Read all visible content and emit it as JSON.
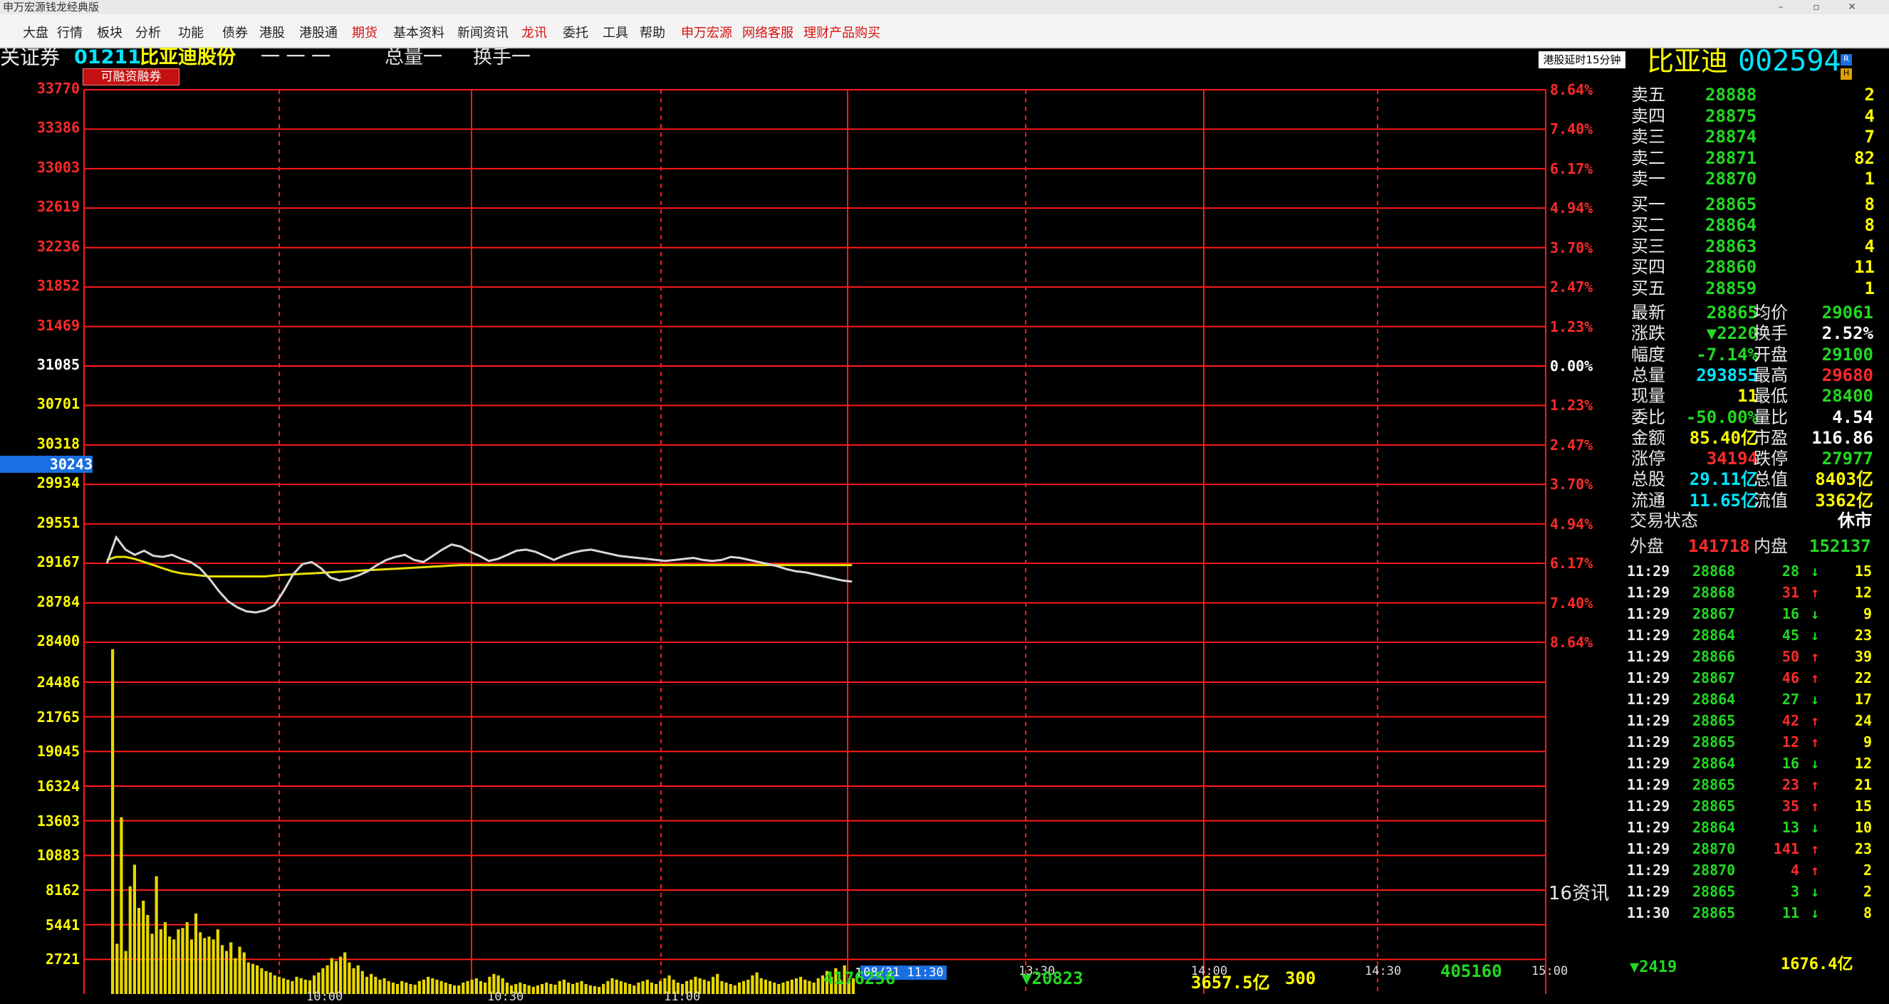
{
  "window": {
    "title": "申万宏源钱龙经典版"
  },
  "menu": [
    "大盘",
    "行情",
    "板块",
    "分析",
    "功能",
    "债券",
    "港股",
    "港股通",
    "期货",
    "基本资料",
    "新闻资讯",
    "龙讯",
    "委托",
    "工具",
    "帮助",
    "申万宏源",
    "网络客服",
    "理财产品购买"
  ],
  "header": {
    "category": "关证券",
    "code": "01211",
    "name": "比亚迪股份",
    "dashes": "一 一 一",
    "vol_label": "总量一",
    "turnover_label": "换手一",
    "margin_badge": "可融资融券",
    "delay_note": "港股延时15分钟",
    "right_name": "比亚迪",
    "right_code": "002594"
  },
  "chart_data": {
    "type": "line",
    "left_axis_ticks": [
      "33770",
      "33386",
      "33003",
      "32619",
      "32236",
      "31852",
      "31469",
      "31085",
      "30701",
      "30318",
      "29934",
      "29551",
      "29167",
      "28784",
      "28400"
    ],
    "right_axis_ticks": [
      "8.64%",
      "7.40%",
      "6.17%",
      "4.94%",
      "3.70%",
      "2.47%",
      "1.23%",
      "0.00%",
      "1.23%",
      "2.47%",
      "3.70%",
      "4.94%",
      "6.17%",
      "7.40%",
      "8.64%"
    ],
    "volume_ticks": [
      "24486",
      "21765",
      "19045",
      "16324",
      "13603",
      "10883",
      "8162",
      "5441",
      "2721"
    ],
    "cursor_value": "30243",
    "x_ticks": [
      "10:00",
      "10:30",
      "11:00",
      "13:30",
      "14:00",
      "14:30",
      "15:00"
    ],
    "x_partial": "11",
    "timestamp": "08/31 11:30",
    "price_series": [
      29167,
      29420,
      29300,
      29250,
      29290,
      29240,
      29230,
      29250,
      29210,
      29180,
      29120,
      29020,
      28900,
      28800,
      28740,
      28700,
      28690,
      28710,
      28760,
      28900,
      29060,
      29160,
      29180,
      29120,
      29030,
      29000,
      29020,
      29050,
      29090,
      29150,
      29200,
      29230,
      29250,
      29200,
      29180,
      29240,
      29300,
      29350,
      29330,
      29280,
      29240,
      29190,
      29210,
      29250,
      29290,
      29300,
      29280,
      29240,
      29200,
      29240,
      29270,
      29290,
      29300,
      29280,
      29260,
      29240,
      29230,
      29220,
      29210,
      29200,
      29190,
      29200,
      29210,
      29220,
      29200,
      29190,
      29200,
      29230,
      29220,
      29200,
      29180,
      29160,
      29140,
      29110,
      29090,
      29080,
      29060,
      29040,
      29020,
      29000,
      28990
    ],
    "avg_series": [
      29200,
      29230,
      29230,
      29210,
      29180,
      29150,
      29120,
      29090,
      29070,
      29060,
      29050,
      29040,
      29040,
      29040,
      29040,
      29040,
      29040,
      29040,
      29050,
      29055,
      29060,
      29065,
      29070,
      29075,
      29080,
      29085,
      29090,
      29095,
      29100,
      29105,
      29110,
      29115,
      29120,
      29125,
      29130,
      29135,
      29140,
      29145,
      29150,
      29150,
      29150,
      29150,
      29150,
      29150,
      29150,
      29150,
      29150,
      29150,
      29150,
      29150,
      29150,
      29150,
      29150,
      29150,
      29150,
      29150,
      29150,
      29150,
      29150,
      29150,
      29150,
      29150,
      29150,
      29150,
      29150,
      29150,
      29150,
      29150,
      29150,
      29150,
      29150,
      29150,
      29150,
      29150,
      29150,
      29150,
      29150,
      29150,
      29150,
      29150,
      29150
    ],
    "volume_bars": [
      24000,
      3500,
      12300,
      3000,
      7500,
      9000,
      6000,
      6500,
      5500,
      4200,
      8200,
      4500,
      5000,
      4000,
      3800,
      4500,
      4600,
      5000,
      3800,
      5600,
      4300,
      3900,
      4000,
      3800,
      4500,
      3400,
      3000,
      3600,
      2500,
      3300,
      2900,
      2200,
      2100,
      2000,
      1800,
      1600,
      1500,
      1300,
      1200,
      1100,
      1000,
      900,
      1200,
      1100,
      1000,
      950,
      1300,
      1500,
      1800,
      2000,
      2500,
      2300,
      2600,
      2900,
      2200,
      1800,
      2000,
      1600,
      1200,
      1400,
      1200,
      1000,
      1100,
      900,
      800,
      700,
      900,
      800,
      700,
      650,
      900,
      1000,
      1200,
      1100,
      1000,
      900,
      800,
      700,
      600,
      600,
      800,
      900,
      1000,
      1100,
      900,
      800,
      1200,
      1400,
      1300,
      1100,
      800,
      600,
      700,
      800,
      700,
      600,
      500,
      600,
      700,
      800,
      700,
      650,
      900,
      1000,
      800,
      700,
      800,
      900,
      700,
      600,
      550,
      500,
      700,
      900,
      1100,
      1000,
      900,
      800,
      700,
      600,
      800,
      900,
      1000,
      800,
      700,
      900,
      1100,
      1300,
      1000,
      800,
      700,
      900,
      1000,
      1200,
      1100,
      1000,
      900,
      1200,
      1400,
      900,
      800,
      700,
      600,
      800,
      900,
      1000,
      1300,
      1500,
      1100,
      1000,
      900,
      800,
      700,
      800,
      900,
      1000,
      1100,
      1200,
      1000,
      900,
      800,
      1100,
      1300,
      1600,
      1200,
      1800,
      1000,
      2000,
      900,
      1100
    ]
  },
  "order_book": {
    "sell": [
      {
        "label": "卖五",
        "price": "28888",
        "vol": "2"
      },
      {
        "label": "卖四",
        "price": "28875",
        "vol": "4"
      },
      {
        "label": "卖三",
        "price": "28874",
        "vol": "7"
      },
      {
        "label": "卖二",
        "price": "28871",
        "vol": "82"
      },
      {
        "label": "卖一",
        "price": "28870",
        "vol": "1"
      }
    ],
    "buy": [
      {
        "label": "买一",
        "price": "28865",
        "vol": "8"
      },
      {
        "label": "买二",
        "price": "28864",
        "vol": "8"
      },
      {
        "label": "买三",
        "price": "28863",
        "vol": "4"
      },
      {
        "label": "买四",
        "price": "28860",
        "vol": "11"
      },
      {
        "label": "买五",
        "price": "28859",
        "vol": "1"
      }
    ]
  },
  "quote": [
    {
      "l1": "最新",
      "v1": "28865",
      "l2": "均价",
      "v2": "29061"
    },
    {
      "l1": "涨跌",
      "v1": "▼2220",
      "l2": "换手",
      "v2": "2.52%"
    },
    {
      "l1": "幅度",
      "v1": "-7.14%",
      "l2": "开盘",
      "v2": "29100"
    },
    {
      "l1": "总量",
      "v1": "293855",
      "l2": "最高",
      "v2": "29680"
    },
    {
      "l1": "现量",
      "v1": "11",
      "l2": "最低",
      "v2": "28400"
    },
    {
      "l1": "委比",
      "v1": "-50.00%",
      "l2": "量比",
      "v2": "4.54"
    },
    {
      "l1": "金额",
      "v1": "85.40亿",
      "l2": "市盈",
      "v2": "116.86"
    },
    {
      "l1": "涨停",
      "v1": "34194",
      "l2": "跌停",
      "v2": "27977"
    },
    {
      "l1": "总股",
      "v1": "29.11亿",
      "l2": "总值",
      "v2": "8403亿"
    },
    {
      "l1": "流通",
      "v1": "11.65亿",
      "l2": "流值",
      "v2": "3362亿"
    }
  ],
  "status": {
    "label": "交易状态",
    "value": "休市"
  },
  "outer_inner": {
    "outer_label": "外盘",
    "outer": "141718",
    "inner_label": "内盘",
    "inner": "152137"
  },
  "ticks": [
    {
      "t": "11:29",
      "p": "28868",
      "v": "28",
      "d": "down",
      "n": "15"
    },
    {
      "t": "11:29",
      "p": "28868",
      "v": "31",
      "d": "up",
      "n": "12"
    },
    {
      "t": "11:29",
      "p": "28867",
      "v": "16",
      "d": "down",
      "n": "9"
    },
    {
      "t": "11:29",
      "p": "28864",
      "v": "45",
      "d": "down",
      "n": "23"
    },
    {
      "t": "11:29",
      "p": "28866",
      "v": "50",
      "d": "up",
      "n": "39"
    },
    {
      "t": "11:29",
      "p": "28867",
      "v": "46",
      "d": "up",
      "n": "22"
    },
    {
      "t": "11:29",
      "p": "28864",
      "v": "27",
      "d": "down",
      "n": "17"
    },
    {
      "t": "11:29",
      "p": "28865",
      "v": "42",
      "d": "up",
      "n": "24"
    },
    {
      "t": "11:29",
      "p": "28865",
      "v": "12",
      "d": "up",
      "n": "9"
    },
    {
      "t": "11:29",
      "p": "28864",
      "v": "16",
      "d": "down",
      "n": "12"
    },
    {
      "t": "11:29",
      "p": "28865",
      "v": "23",
      "d": "up",
      "n": "21"
    },
    {
      "t": "11:29",
      "p": "28865",
      "v": "35",
      "d": "up",
      "n": "15"
    },
    {
      "t": "11:29",
      "p": "28864",
      "v": "13",
      "d": "down",
      "n": "10"
    },
    {
      "t": "11:29",
      "p": "28870",
      "v": "141",
      "d": "up",
      "n": "23"
    },
    {
      "t": "11:29",
      "p": "28870",
      "v": "4",
      "d": "up",
      "n": "2"
    },
    {
      "t": "11:29",
      "p": "28865",
      "v": "3",
      "d": "down",
      "n": "2"
    },
    {
      "t": "11:30",
      "p": "28865",
      "v": "11",
      "d": "down",
      "n": "8"
    }
  ],
  "info_label": "16资讯",
  "footer": {
    "vol": "4176256",
    "down": "▼20823",
    "amount": "3657.5亿",
    "count": "300",
    "buy": "405160",
    "right_down": "▼2419",
    "right_amount": "1676.4亿"
  },
  "colors": {
    "grid": "#ff1a1a",
    "price_line": "#d8d8d8",
    "avg_line": "#e8e000",
    "volume": "#e8d800",
    "up": "#ff2a2a",
    "down": "#22d822",
    "yellow": "#ffff00",
    "cyan": "#00e5ff"
  }
}
